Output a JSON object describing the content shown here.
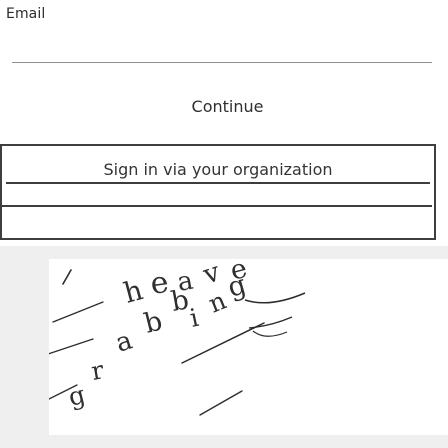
{
  "email": {
    "label": "Email",
    "value": ""
  },
  "continue_button": {
    "label": "Continue"
  },
  "organization": {
    "button_label": "Sign in via your organization"
  },
  "captcha": {
    "text": "heave grabbing"
  }
}
